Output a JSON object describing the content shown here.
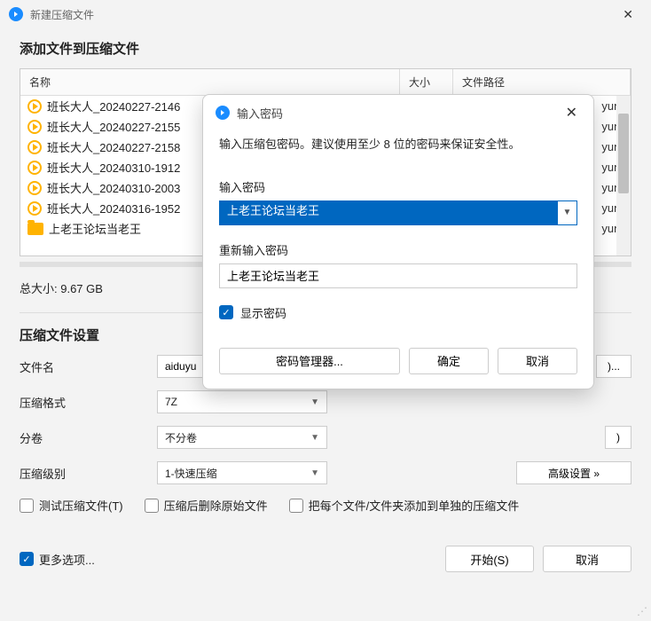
{
  "window": {
    "title": "新建压缩文件"
  },
  "main": {
    "heading": "添加文件到压缩文件",
    "columns": {
      "name": "名称",
      "size": "大小",
      "path": "文件路径"
    },
    "files": [
      {
        "name": "班长大人_20240227-2146",
        "path": "yun\\"
      },
      {
        "name": "班长大人_20240227-2155",
        "path": "yun\\"
      },
      {
        "name": "班长大人_20240227-2158",
        "path": "yun\\"
      },
      {
        "name": "班长大人_20240310-1912",
        "path": "yun\\"
      },
      {
        "name": "班长大人_20240310-2003",
        "path": "yun\\"
      },
      {
        "name": "班长大人_20240316-1952",
        "path": "yun\\"
      }
    ],
    "folder": {
      "name": "上老王论坛当老王",
      "path": "yun\\"
    },
    "total_size": "总大小: 9.67 GB",
    "settings_heading": "压缩文件设置",
    "filename_label": "文件名",
    "filename_value": "aiduyu",
    "filename_btn": ")...",
    "format_label": "压缩格式",
    "format_value": "7Z",
    "split_label": "分卷",
    "split_value": "不分卷",
    "split_btn": ")",
    "level_label": "压缩级别",
    "level_value": "1-快速压缩",
    "advanced_btn": "高级设置 »",
    "cb_test": "测试压缩文件(T)",
    "cb_delete": "压缩后删除原始文件",
    "cb_separate": "把每个文件/文件夹添加到单独的压缩文件",
    "more_options": "更多选项...",
    "start_btn": "开始(S)",
    "cancel_btn": "取消"
  },
  "modal": {
    "title": "输入密码",
    "hint": "输入压缩包密码。建议使用至少 8 位的密码来保证安全性。",
    "pw_label": "输入密码",
    "pw_value": "上老王论坛当老王",
    "pw2_label": "重新输入密码",
    "pw2_value": "上老王论坛当老王",
    "show_pw": "显示密码",
    "manager_btn": "密码管理器...",
    "ok_btn": "确定",
    "cancel_btn": "取消"
  }
}
